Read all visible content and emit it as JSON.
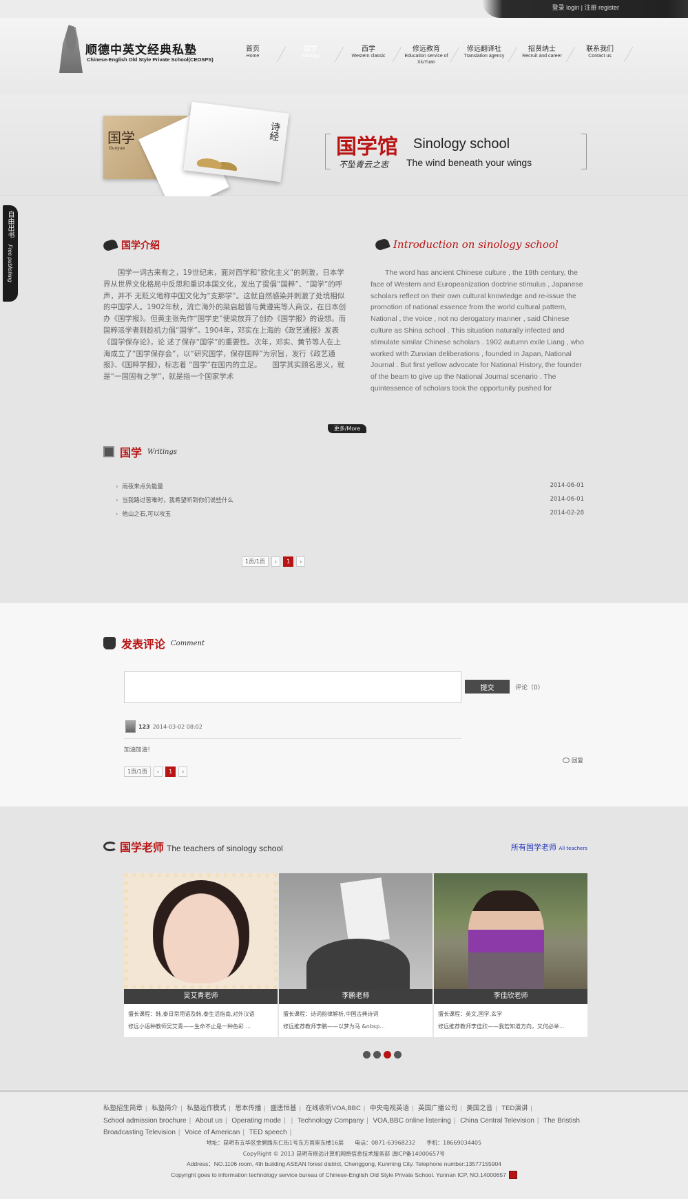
{
  "top": {
    "login": "登录 login",
    "register": "注册 register"
  },
  "logo": {
    "title_cn": "顺德中英文经典私塾",
    "title_en": "Chinese-English Old Style Private School(CEOSPS)"
  },
  "nav": [
    {
      "cn": "首页",
      "en": "Home"
    },
    {
      "cn": "国学",
      "en": "Sinology"
    },
    {
      "cn": "西学",
      "en": "Western classic"
    },
    {
      "cn": "修远教育",
      "en": "Education service of XiuYuan"
    },
    {
      "cn": "修远翻译社",
      "en": "Translation agency"
    },
    {
      "cn": "招贤纳士",
      "en": "Recruit and career"
    },
    {
      "cn": "联系我们",
      "en": "Contact us"
    }
  ],
  "banner": {
    "card_text": "国学",
    "card_sub": "Guoyue",
    "card3_text": "诗经",
    "title_cn": "国学馆",
    "title_en": "Sinology school",
    "slogan_cn": "不坠青云之志",
    "slogan_en": "The wind beneath your wings"
  },
  "side_tab": {
    "cn": "自由出书",
    "en": "Free publishing"
  },
  "intro": {
    "head_cn": "国学介绍",
    "head_en": "Introduction on sinology school",
    "text_cn": "国学一词古来有之，19世纪末，面对西学和“欧化主义”的刺激，日本学界从世界文化格局中反思和重识本国文化，发出了提倡“国粹”、“国学”的呼声，并不 无贬义地称中国文化为“支那学”。这就自然感染并刺激了处境相似的中国学人。1902年秋，流亡海外的梁启超曾与黄遵宪等人商议，在日本创办《国学报》。但黄主张先作“国学史”使梁放弃了创办《国学报》的设想。而国粹派学者则趁机力倡“国学”。1904年，邓实在上海的《政艺通报》发表《国学保存论》，论 述了保存“国学”的重要性。次年，邓实、黄节等人在上海成立了“国学保存会”，以“研究国学，保存国粹”为宗旨，发行《政艺通报》、《国粹学报》，标志着 “国学”在国内的立足。　　国学其实顾名思义，就是“一国固有之学”，就是指一个国家学术",
    "text_en": "The word has ancient Chinese culture , the 19th century, the face of Western and Europeanization doctrine stimulus , Japanese scholars reflect on their own cultural knowledge and re-issue the promotion of national essence from the world cultural pattern, National , the voice , not no derogatory manner , said Chinese culture as Shina school . This situation naturally infected and stimulate similar Chinese scholars . 1902 autumn exile Liang , who worked with Zunxian deliberations , founded in Japan, National Journal . But first yellow advocate for National History, the founder of the beam to give up the National Journal scenario . The quintessence of scholars took the opportunity pushed for",
    "more": "更多/More"
  },
  "writings": {
    "title": "国学",
    "subtitle": "Writings",
    "items": [
      {
        "title": "雨夜来点负能量",
        "date": "2014-06-01"
      },
      {
        "title": "当我路过苦难时，我希望听到你们说些什么",
        "date": "2014-06-01"
      },
      {
        "title": "他山之石,可以攻玉",
        "date": "2014-02-28"
      }
    ],
    "pager": {
      "info": "1页/1页",
      "prev": "‹",
      "current": "1",
      "next": "›"
    }
  },
  "comment": {
    "title": "发表评论",
    "subtitle": "Comment",
    "submit": "提交",
    "count": "评论（0）",
    "user": "123",
    "time": "2014-03-02 08:02",
    "text": "加油加油！",
    "reply": "回复",
    "pager": {
      "info": "1页/1页",
      "prev": "‹",
      "current": "1",
      "next": "›"
    }
  },
  "teachers": {
    "title_cn": "国学老师",
    "title_en": "The teachers of sinology school",
    "all_cn": "所有国学老师",
    "all_en": "All teachers",
    "list": [
      {
        "name": "吴艾青老师",
        "line1": "擅长课程：韩,泰日常用语及韩,泰生活指南,对外汉语",
        "line2": "修远小语种教师吴艾青——生命不止是一种色彩 ..."
      },
      {
        "name": "李鹏老师",
        "line1": "擅长课程：诗词韵律解析,中国古典诗词",
        "line2": "修远推荐教师李鹏——以梦为马  &nbsp..."
      },
      {
        "name": "李佳欣老师",
        "line1": "擅长课程：英文,国学,玄学",
        "line2": "修远推荐教师李佳欣——我若知道方向，又何必举..."
      }
    ]
  },
  "footer": {
    "links_cn": [
      "私塾招生简章",
      "私塾简介",
      "私塾运作模式",
      "思本传播",
      "盛唐恒基",
      "在线收听VOA,BBC",
      "中央电视英语",
      "英国广播公司",
      "美国之音",
      "TED演讲"
    ],
    "links_en": [
      "School admission brochure",
      "About us",
      "Operating mode",
      "",
      "Technology Company",
      "VOA,BBC online listening",
      "China Central Television",
      "The Bristish Broadcasting Television",
      "Voice of American",
      "TED speech"
    ],
    "address_cn": "地址：昆明市五华区金碧路东仁街1号东方首座东楼16层　　电话：0871-63968232　　手机：18669034405",
    "copyright_cn": "CopyRight © 2013 昆明市修远计算机网络信息技术服务部 滇ICP备14000657号",
    "address_en": "Address：NO.1106 room, 4th building ASEAN forest district, Chenggong, Kunming City. Telephone number:13577155904",
    "copyright_en": "Copyright goes to information technology service bureau of Chinese-English Old Style Private School. Yunnan ICP, NO.14000657"
  },
  "colors": {
    "accent": "#b81414",
    "dark": "#222222",
    "link": "#2233bb"
  }
}
